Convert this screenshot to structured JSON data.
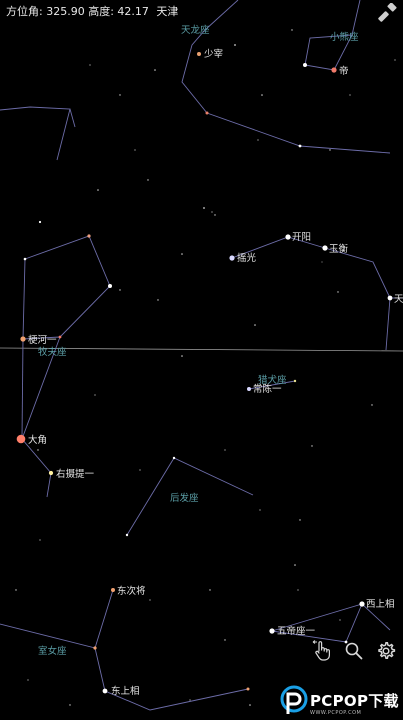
{
  "readout": {
    "azimuth_label": "方位角",
    "azimuth_value": "325.90",
    "altitude_label": "高度",
    "altitude_value": "42.17",
    "overlay_label": "天津"
  },
  "colors": {
    "constellation_line": "#6c6ca8",
    "constellation_label": "#5b9ea6",
    "star_label": "#e6e6e6",
    "horizon": "#9a9a9a",
    "accent_blue": "#1aa0e6"
  },
  "constellation_labels": [
    {
      "id": "draco",
      "text": "天龙座"
    },
    {
      "id": "ursa-minor",
      "text": "小熊座"
    },
    {
      "id": "bootes",
      "text": "牧夫座"
    },
    {
      "id": "canes-venatici",
      "text": "猎犬座"
    },
    {
      "id": "coma-berenices",
      "text": "后发座"
    },
    {
      "id": "virgo",
      "text": "室女座"
    }
  ],
  "star_labels": [
    {
      "id": "shaozai",
      "text": "少宰"
    },
    {
      "id": "di",
      "text": "帝"
    },
    {
      "id": "kaiyang",
      "text": "开阳"
    },
    {
      "id": "yuheng",
      "text": "玉衡"
    },
    {
      "id": "yaoguang",
      "text": "摇光"
    },
    {
      "id": "tian",
      "text": "天"
    },
    {
      "id": "genghe",
      "text": "梗河一"
    },
    {
      "id": "changchen",
      "text": "常陈一"
    },
    {
      "id": "dajiao",
      "text": "大角"
    },
    {
      "id": "youshe",
      "text": "右摄提一"
    },
    {
      "id": "dongcijiang",
      "text": "东次将"
    },
    {
      "id": "xishangxiang",
      "text": "西上相"
    },
    {
      "id": "wudizuo",
      "text": "五帝座一"
    },
    {
      "id": "dongshangxiang",
      "text": "东上相"
    }
  ],
  "toolbar": {
    "flashlight_icon": "flashlight-icon",
    "hand_icon": "hand-pointer-icon",
    "search_icon": "search-icon",
    "settings_icon": "gear-icon"
  },
  "watermark": {
    "text": "PCPOP下载",
    "subtext": "WWW.PCPOP.COM"
  }
}
